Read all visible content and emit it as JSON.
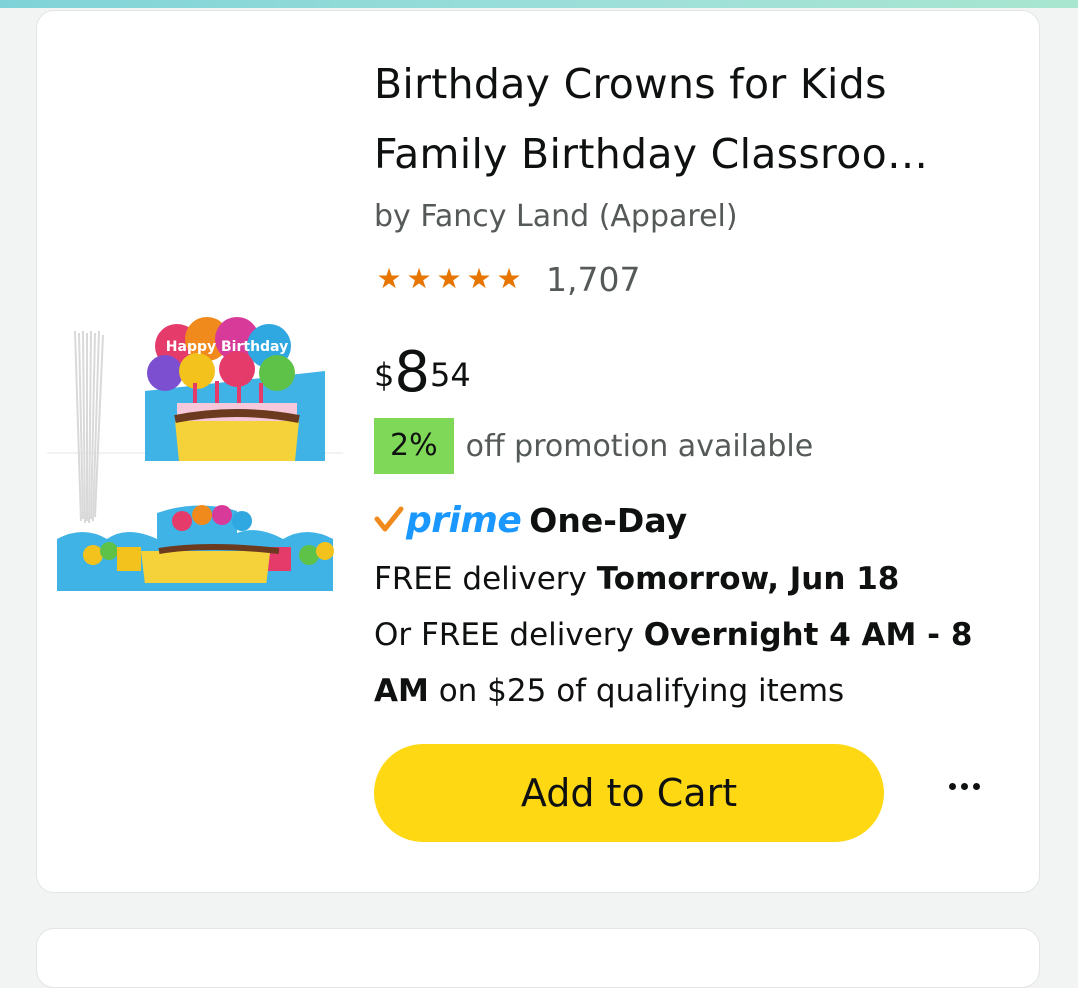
{
  "product": {
    "title_line1": "Birthday Crowns for Kids",
    "title_line2": "Family Birthday Classroo…",
    "byline": "by Fancy Land (Apparel)",
    "rating_stars": 5,
    "review_count": "1,707",
    "price": {
      "symbol": "$",
      "whole": "8",
      "fraction": "54"
    },
    "promo": {
      "badge": "2%",
      "text": "off promotion available"
    },
    "prime": {
      "label": "prime",
      "speed": "One-Day"
    },
    "delivery": {
      "line1_prefix": "FREE delivery ",
      "line1_bold": "Tomorrow, Jun 18",
      "line2_prefix": "Or FREE delivery ",
      "line2_bold": "Overnight 4 AM - 8 AM",
      "line2_suffix": " on $25 of qualifying items"
    },
    "add_to_cart_label": "Add to Cart",
    "image_text": "Happy Birthday"
  },
  "colors": {
    "cart_button": "#ffd814",
    "promo_badge": "#7fd858",
    "prime_blue": "#1a98ff",
    "star_orange": "#e77600"
  }
}
